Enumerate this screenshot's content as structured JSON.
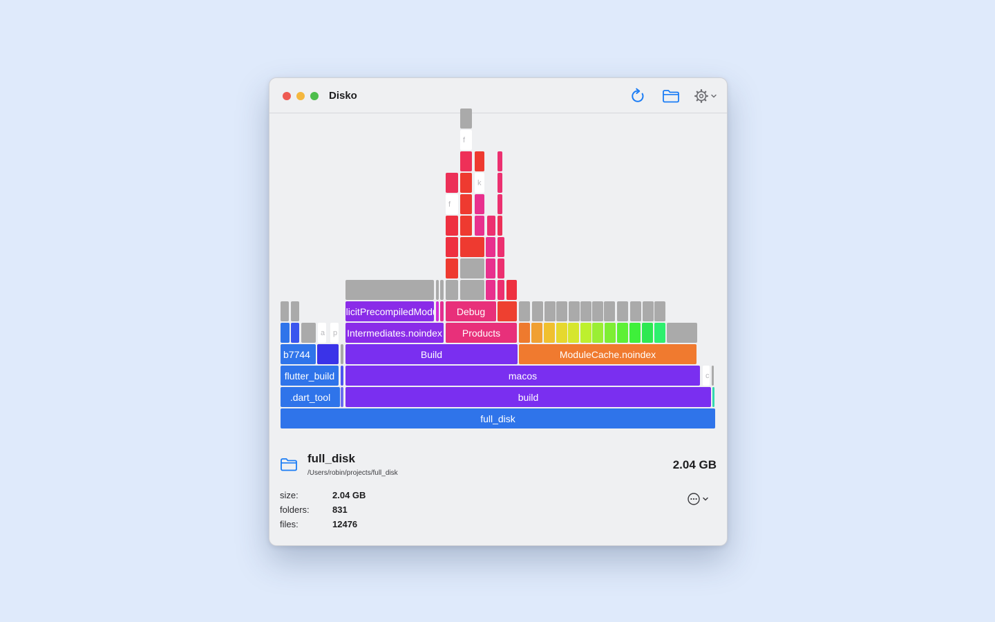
{
  "window": {
    "title": "Disko"
  },
  "toolbar": {
    "refresh_icon": "arrow-clockwise-icon",
    "open_icon": "folder-icon",
    "settings_icon": "gear-icon",
    "accent": "#1a7cf5"
  },
  "segments": [
    {
      "t": "full_disk",
      "c": "#2f74ea"
    },
    {
      "t": ".dart_tool",
      "c": "#2f74ea"
    },
    {
      "t": "",
      "c": "#6a6cf0"
    },
    {
      "t": "build",
      "c": "#7a2ff0"
    },
    {
      "t": "",
      "c": "#34d8b0"
    },
    {
      "t": "flutter_build",
      "c": "#2f74ea"
    },
    {
      "t": "",
      "c": "#4d55f0"
    },
    {
      "t": "macos",
      "c": "#7a2ff0"
    },
    {
      "t": "c",
      "c": "#ffffff",
      "ghost": true
    },
    {
      "t": "",
      "c": "#aaaaaa"
    },
    {
      "t": "b7744",
      "c": "#2f74ea"
    },
    {
      "t": "",
      "c": "#3a33e8"
    },
    {
      "t": "",
      "c": "#a8a8a8"
    },
    {
      "t": "Build",
      "c": "#7a2ff0"
    },
    {
      "t": "ModuleCache.noindex",
      "c": "#f07a2f"
    },
    {
      "t": "",
      "c": "#2f74ea"
    },
    {
      "t": "",
      "c": "#3a55ee"
    },
    {
      "t": "",
      "c": "#aaaaaa"
    },
    {
      "t": "a",
      "c": "#ffffff",
      "ghost": true
    },
    {
      "t": "p",
      "c": "#ffffff",
      "ghost": true
    },
    {
      "t": "Intermediates.noindex",
      "c": "#8a2ce8"
    },
    {
      "t": "Products",
      "c": "#e8307a"
    },
    {
      "t": "",
      "c": "#ee7a2e"
    },
    {
      "t": "",
      "c": "#f0a032"
    },
    {
      "t": "",
      "c": "#f0c02e"
    },
    {
      "t": "",
      "c": "#e6d82e"
    },
    {
      "t": "",
      "c": "#d6e62e"
    },
    {
      "t": "",
      "c": "#bdf02e"
    },
    {
      "t": "",
      "c": "#9aee34"
    },
    {
      "t": "",
      "c": "#7eee34"
    },
    {
      "t": "",
      "c": "#5ef036"
    },
    {
      "t": "",
      "c": "#3ef03a"
    },
    {
      "t": "",
      "c": "#2ee852"
    },
    {
      "t": "",
      "c": "#2ef06e"
    },
    {
      "t": "",
      "c": "#aaaaaa"
    },
    {
      "t": "",
      "c": "#aaaaaa"
    },
    {
      "t": "",
      "c": "#aaaaaa"
    },
    {
      "t": "ExplicitPrecompiledModules",
      "c": "#8a2ce8"
    },
    {
      "t": "",
      "c": "#d22cd8"
    },
    {
      "t": "",
      "c": "#e23090"
    },
    {
      "t": "Debug",
      "c": "#e8307a"
    },
    {
      "t": "",
      "c": "#ee4030"
    },
    {
      "t": "",
      "c": "#aaaaaa"
    },
    {
      "t": "",
      "c": "#aaaaaa"
    },
    {
      "t": "",
      "c": "#aaaaaa"
    },
    {
      "t": "",
      "c": "#aaaaaa"
    },
    {
      "t": "",
      "c": "#aaaaaa"
    },
    {
      "t": "",
      "c": "#aaaaaa"
    },
    {
      "t": "",
      "c": "#aaaaaa"
    },
    {
      "t": "",
      "c": "#aaaaaa"
    },
    {
      "t": "",
      "c": "#aaaaaa"
    },
    {
      "t": "",
      "c": "#aaaaaa"
    },
    {
      "t": "",
      "c": "#aaaaaa"
    },
    {
      "t": "",
      "c": "#aaaaaa"
    },
    {
      "t": "",
      "c": "#aaaaaa"
    },
    {
      "t": "",
      "c": "#aaaaaa"
    },
    {
      "t": "",
      "c": "#aaaaaa"
    },
    {
      "t": "",
      "c": "#aaaaaa"
    },
    {
      "t": "",
      "c": "#aaaaaa"
    },
    {
      "t": "",
      "c": "#e8308e"
    },
    {
      "t": "",
      "c": "#ec3070"
    },
    {
      "t": "",
      "c": "#ee3040"
    },
    {
      "t": "",
      "c": "#ee3a30"
    },
    {
      "t": "",
      "c": "#aaaaaa"
    },
    {
      "t": "",
      "c": "#e8308e"
    },
    {
      "t": "",
      "c": "#ec3070"
    },
    {
      "t": "",
      "c": "#ee3040"
    },
    {
      "t": "",
      "c": "#ee3a30"
    },
    {
      "t": "",
      "c": "#e8308e"
    },
    {
      "t": "",
      "c": "#ec3070"
    },
    {
      "t": "",
      "c": "#ee3040"
    },
    {
      "t": "",
      "c": "#ee3a30"
    },
    {
      "t": "",
      "c": "#e8308e"
    },
    {
      "t": "",
      "c": "#ec3070"
    },
    {
      "t": "",
      "c": "#ec3058"
    },
    {
      "t": "f",
      "c": "#ffffff",
      "ghost": true
    },
    {
      "t": "",
      "c": "#ee3a30"
    },
    {
      "t": "",
      "c": "#e8308e"
    },
    {
      "t": "",
      "c": "#ec3070"
    },
    {
      "t": "",
      "c": "#ec3058"
    },
    {
      "t": "",
      "c": "#ee3a30"
    },
    {
      "t": "k",
      "c": "#ffffff",
      "ghost": true
    },
    {
      "t": "",
      "c": "#ec3070"
    },
    {
      "t": "",
      "c": "#ee3058"
    },
    {
      "t": "",
      "c": "#ee3a30"
    },
    {
      "t": "",
      "c": "#ec3070"
    },
    {
      "t": "f",
      "c": "#ffffff",
      "ghost": true
    },
    {
      "t": "",
      "c": "#aaaaaa"
    },
    {
      "t": "",
      "c": "#ec3070"
    },
    {
      "t": "k",
      "c": "#ffffff",
      "ghost": true
    }
  ],
  "info": {
    "folder_icon": "folder-icon",
    "name": "full_disk",
    "path": "/Users/robin/projects/full_disk",
    "size": "2.04 GB",
    "more_icon": "ellipsis-circle-icon"
  },
  "stats": [
    {
      "label": "size:",
      "value": "2.04 GB"
    },
    {
      "label": "folders:",
      "value": "831"
    },
    {
      "label": "files:",
      "value": "12476"
    }
  ]
}
